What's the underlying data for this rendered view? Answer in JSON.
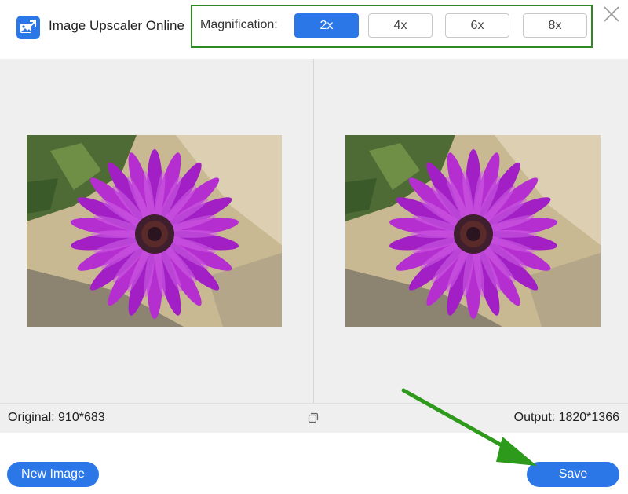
{
  "app": {
    "title": "Image Upscaler Online"
  },
  "magnification": {
    "label": "Magnification:",
    "options": [
      "2x",
      "4x",
      "6x",
      "8x"
    ],
    "selected": "2x"
  },
  "info": {
    "original_label": "Original:",
    "original_size": "910*683",
    "output_label": "Output:",
    "output_size": "1820*1366"
  },
  "buttons": {
    "new_image": "New Image",
    "save": "Save"
  },
  "colors": {
    "accent": "#2b77e8",
    "highlight_border": "#2e8a22",
    "arrow": "#2e9a1c"
  }
}
